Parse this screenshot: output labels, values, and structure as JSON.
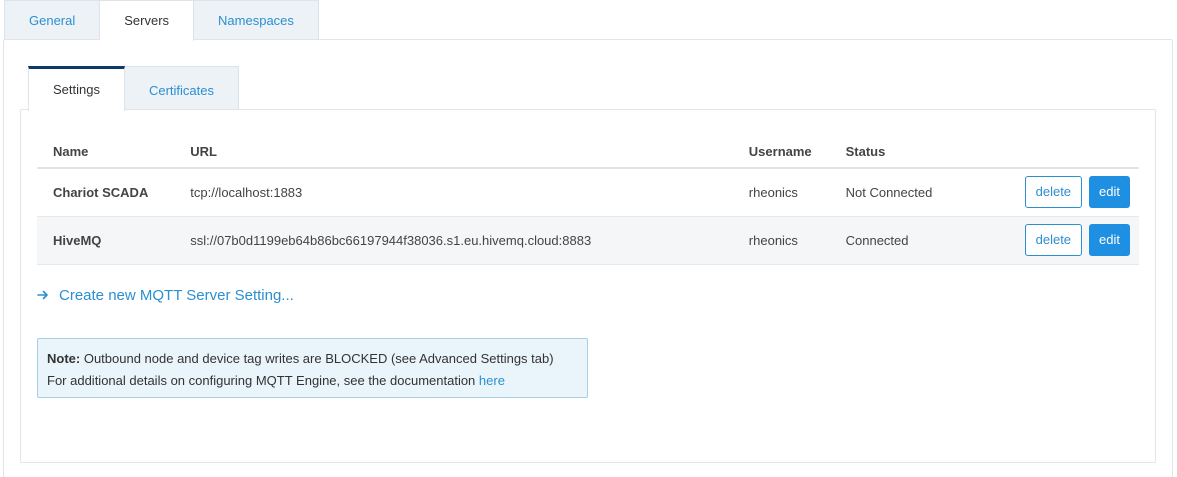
{
  "top_tabs": [
    {
      "label": "General"
    },
    {
      "label": "Servers",
      "active": true
    },
    {
      "label": "Namespaces"
    }
  ],
  "sub_tabs": [
    {
      "label": "Settings",
      "active": true
    },
    {
      "label": "Certificates"
    }
  ],
  "table": {
    "headers": {
      "name": "Name",
      "url": "URL",
      "username": "Username",
      "status": "Status"
    },
    "rows": [
      {
        "name": "Chariot SCADA",
        "url": "tcp://localhost:1883",
        "username": "rheonics",
        "status": "Not Connected",
        "delete_label": "delete",
        "edit_label": "edit"
      },
      {
        "name": "HiveMQ",
        "url": "ssl://07b0d1199eb64b86bc66197944f38036.s1.eu.hivemq.cloud:8883",
        "username": "rheonics",
        "status": "Connected",
        "delete_label": "delete",
        "edit_label": "edit"
      }
    ]
  },
  "create_link": {
    "label": "Create new MQTT Server Setting...",
    "icon": "arrow-right-icon"
  },
  "note": {
    "label": "Note:",
    "line1": " Outbound node and device tag writes are BLOCKED (see Advanced Settings tab)",
    "line2": "For additional details on configuring MQTT Engine, see the documentation ",
    "link": "here"
  },
  "colors": {
    "accent": "#2b8fd1",
    "button_fill": "#1e8fe1",
    "active_tab_bar": "#0c3a6b",
    "note_bg": "#e9f4fb"
  }
}
